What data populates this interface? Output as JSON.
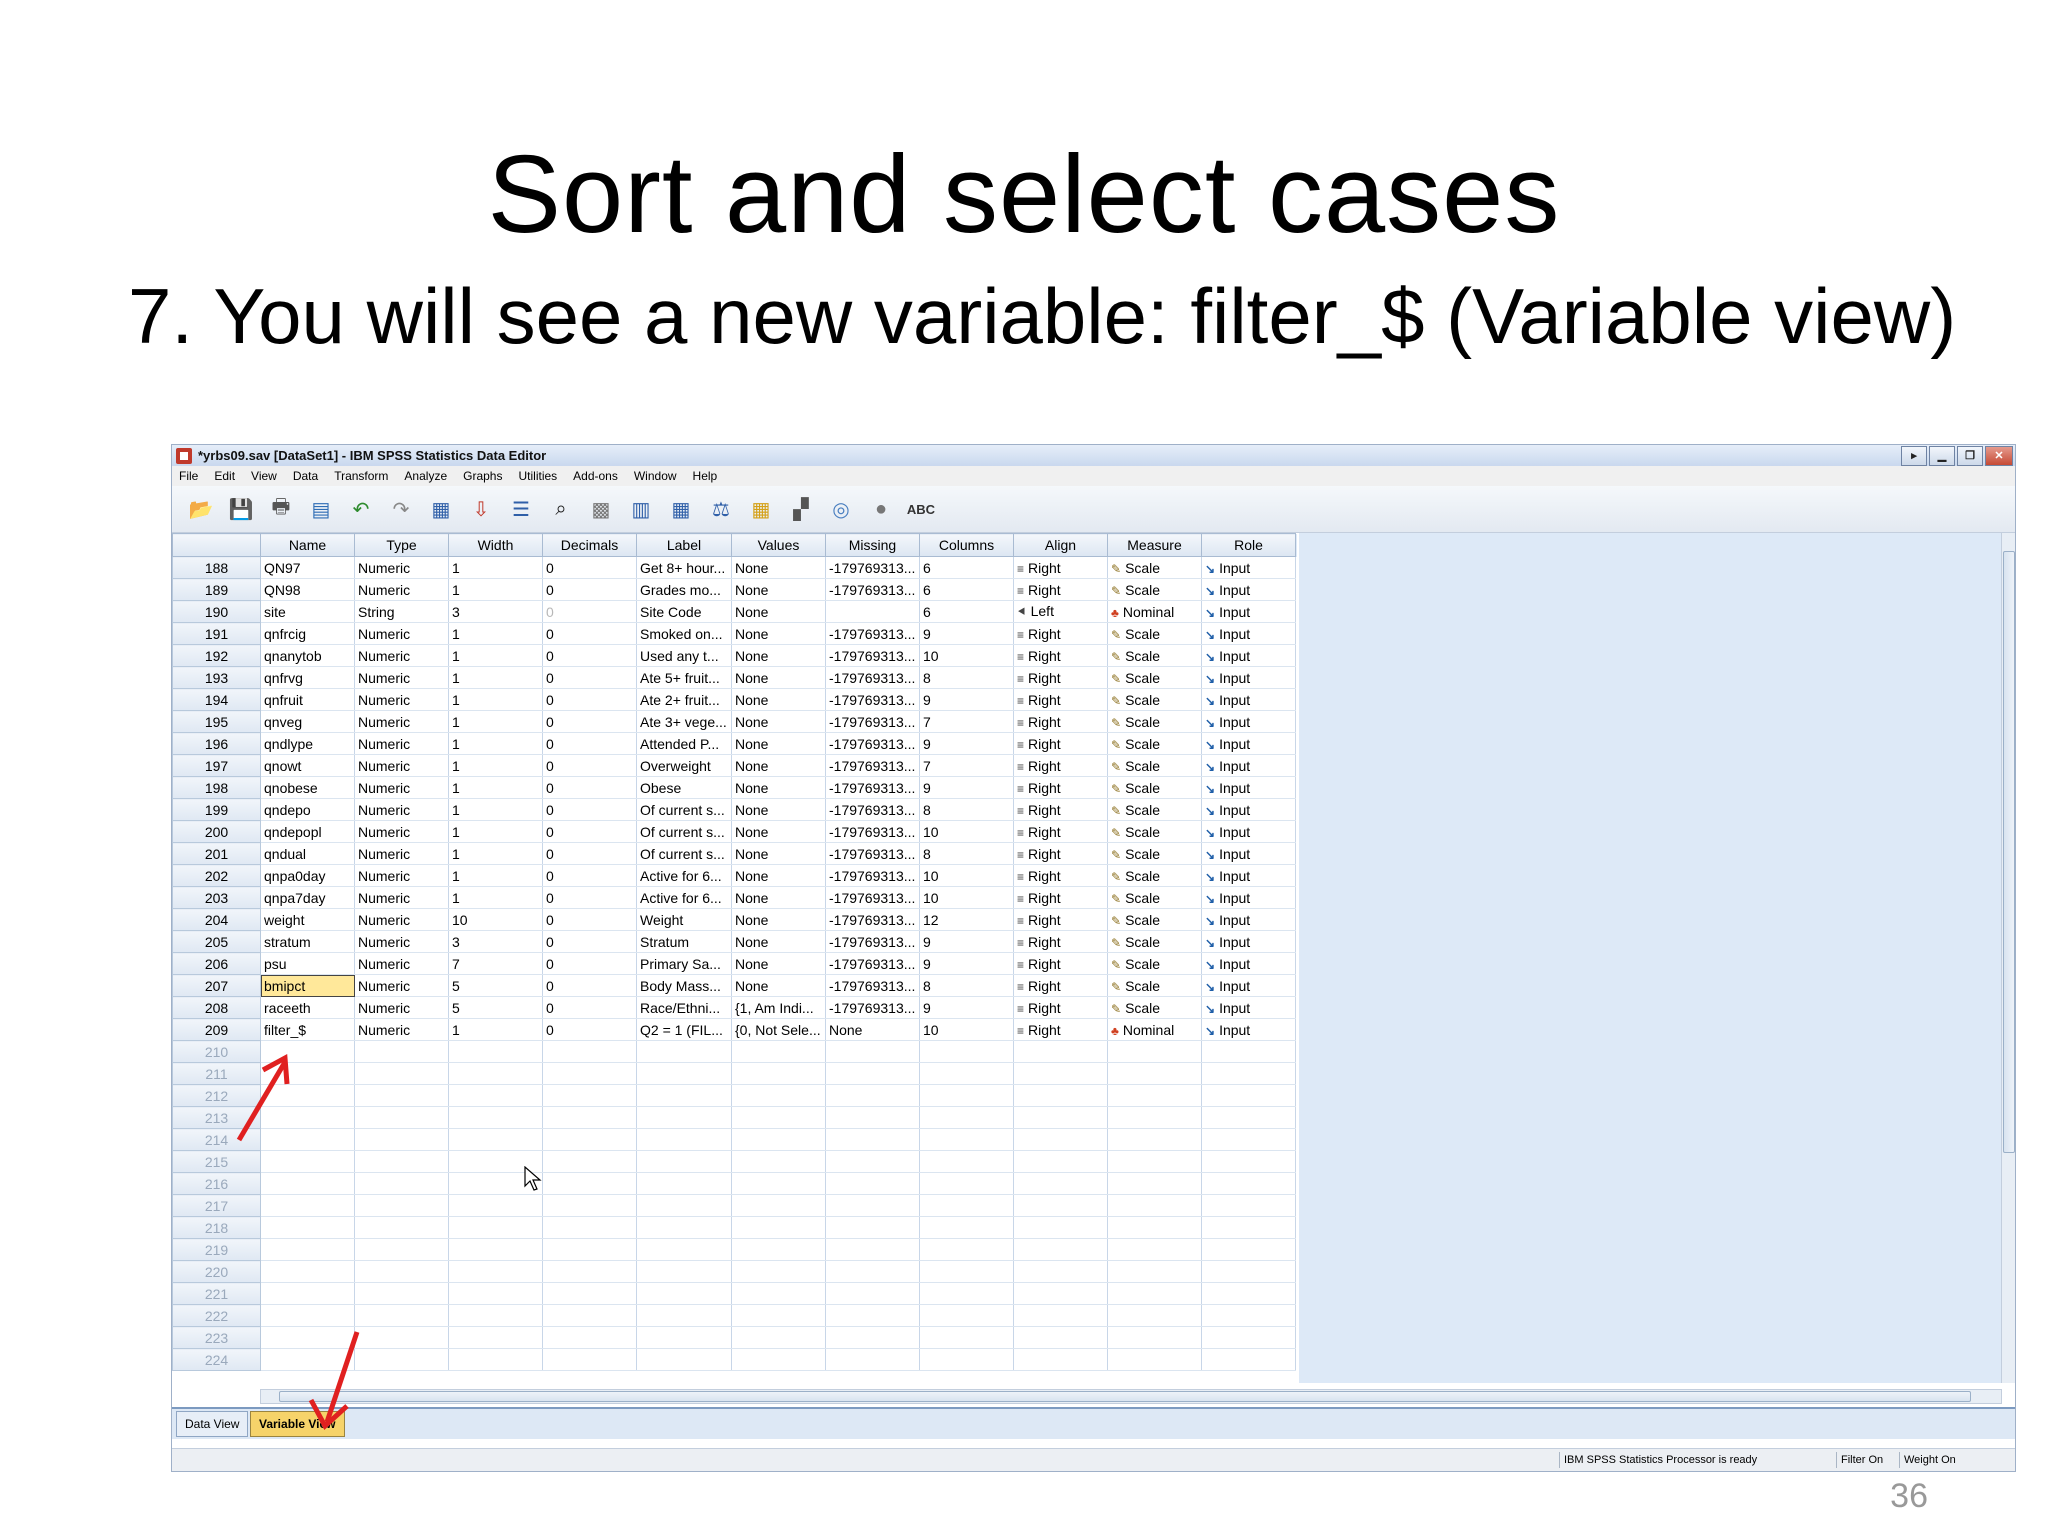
{
  "slide": {
    "title": "Sort and select cases",
    "subtitle": "7. You will see a new variable: filter_$ (Variable view)",
    "page_number": "36"
  },
  "window": {
    "title": "*yrbs09.sav [DataSet1] - IBM SPSS Statistics Data Editor"
  },
  "menu": [
    "File",
    "Edit",
    "View",
    "Data",
    "Transform",
    "Analyze",
    "Graphs",
    "Utilities",
    "Add-ons",
    "Window",
    "Help"
  ],
  "toolbar": {
    "icons": [
      "open-folder-icon",
      "save-icon",
      "print-icon",
      "recall-dialog-icon",
      "undo-icon",
      "redo-icon",
      "goto-case-icon",
      "goto-variable-icon",
      "variables-icon",
      "find-icon",
      "insert-cases-icon",
      "insert-variable-icon",
      "split-file-icon",
      "weight-cases-icon",
      "select-cases-icon",
      "value-labels-icon",
      "use-sets-icon",
      "show-all-icon",
      "spell-check-icon"
    ]
  },
  "grid": {
    "columns": [
      "Name",
      "Type",
      "Width",
      "Decimals",
      "Label",
      "Values",
      "Missing",
      "Columns",
      "Align",
      "Measure",
      "Role"
    ],
    "rows": [
      {
        "n": "188",
        "name": "QN97",
        "type": "Numeric",
        "width": "1",
        "decimals": "0",
        "label": "Get 8+ hour...",
        "values": "None",
        "missing": "-179769313...",
        "columns": "6",
        "align": "Right",
        "measure": "Scale",
        "role": "Input"
      },
      {
        "n": "189",
        "name": "QN98",
        "type": "Numeric",
        "width": "1",
        "decimals": "0",
        "label": "Grades mo...",
        "values": "None",
        "missing": "-179769313...",
        "columns": "6",
        "align": "Right",
        "measure": "Scale",
        "role": "Input"
      },
      {
        "n": "190",
        "name": "site",
        "type": "String",
        "width": "3",
        "decimals": "0",
        "label": "Site Code",
        "values": "None",
        "missing": "",
        "columns": "6",
        "align": "Left",
        "measure": "Nominal",
        "role": "Input"
      },
      {
        "n": "191",
        "name": "qnfrcig",
        "type": "Numeric",
        "width": "1",
        "decimals": "0",
        "label": "Smoked on...",
        "values": "None",
        "missing": "-179769313...",
        "columns": "9",
        "align": "Right",
        "measure": "Scale",
        "role": "Input"
      },
      {
        "n": "192",
        "name": "qnanytob",
        "type": "Numeric",
        "width": "1",
        "decimals": "0",
        "label": "Used any t...",
        "values": "None",
        "missing": "-179769313...",
        "columns": "10",
        "align": "Right",
        "measure": "Scale",
        "role": "Input"
      },
      {
        "n": "193",
        "name": "qnfrvg",
        "type": "Numeric",
        "width": "1",
        "decimals": "0",
        "label": "Ate 5+ fruit...",
        "values": "None",
        "missing": "-179769313...",
        "columns": "8",
        "align": "Right",
        "measure": "Scale",
        "role": "Input"
      },
      {
        "n": "194",
        "name": "qnfruit",
        "type": "Numeric",
        "width": "1",
        "decimals": "0",
        "label": "Ate 2+ fruit...",
        "values": "None",
        "missing": "-179769313...",
        "columns": "9",
        "align": "Right",
        "measure": "Scale",
        "role": "Input"
      },
      {
        "n": "195",
        "name": "qnveg",
        "type": "Numeric",
        "width": "1",
        "decimals": "0",
        "label": "Ate 3+ vege...",
        "values": "None",
        "missing": "-179769313...",
        "columns": "7",
        "align": "Right",
        "measure": "Scale",
        "role": "Input"
      },
      {
        "n": "196",
        "name": "qndlype",
        "type": "Numeric",
        "width": "1",
        "decimals": "0",
        "label": "Attended P...",
        "values": "None",
        "missing": "-179769313...",
        "columns": "9",
        "align": "Right",
        "measure": "Scale",
        "role": "Input"
      },
      {
        "n": "197",
        "name": "qnowt",
        "type": "Numeric",
        "width": "1",
        "decimals": "0",
        "label": "Overweight",
        "values": "None",
        "missing": "-179769313...",
        "columns": "7",
        "align": "Right",
        "measure": "Scale",
        "role": "Input"
      },
      {
        "n": "198",
        "name": "qnobese",
        "type": "Numeric",
        "width": "1",
        "decimals": "0",
        "label": "Obese",
        "values": "None",
        "missing": "-179769313...",
        "columns": "9",
        "align": "Right",
        "measure": "Scale",
        "role": "Input"
      },
      {
        "n": "199",
        "name": "qndepo",
        "type": "Numeric",
        "width": "1",
        "decimals": "0",
        "label": "Of current s...",
        "values": "None",
        "missing": "-179769313...",
        "columns": "8",
        "align": "Right",
        "measure": "Scale",
        "role": "Input"
      },
      {
        "n": "200",
        "name": "qndepopl",
        "type": "Numeric",
        "width": "1",
        "decimals": "0",
        "label": "Of current s...",
        "values": "None",
        "missing": "-179769313...",
        "columns": "10",
        "align": "Right",
        "measure": "Scale",
        "role": "Input"
      },
      {
        "n": "201",
        "name": "qndual",
        "type": "Numeric",
        "width": "1",
        "decimals": "0",
        "label": "Of current s...",
        "values": "None",
        "missing": "-179769313...",
        "columns": "8",
        "align": "Right",
        "measure": "Scale",
        "role": "Input"
      },
      {
        "n": "202",
        "name": "qnpa0day",
        "type": "Numeric",
        "width": "1",
        "decimals": "0",
        "label": "Active for 6...",
        "values": "None",
        "missing": "-179769313...",
        "columns": "10",
        "align": "Right",
        "measure": "Scale",
        "role": "Input"
      },
      {
        "n": "203",
        "name": "qnpa7day",
        "type": "Numeric",
        "width": "1",
        "decimals": "0",
        "label": "Active for 6...",
        "values": "None",
        "missing": "-179769313...",
        "columns": "10",
        "align": "Right",
        "measure": "Scale",
        "role": "Input"
      },
      {
        "n": "204",
        "name": "weight",
        "type": "Numeric",
        "width": "10",
        "decimals": "0",
        "label": "Weight",
        "values": "None",
        "missing": "-179769313...",
        "columns": "12",
        "align": "Right",
        "measure": "Scale",
        "role": "Input"
      },
      {
        "n": "205",
        "name": "stratum",
        "type": "Numeric",
        "width": "3",
        "decimals": "0",
        "label": "Stratum",
        "values": "None",
        "missing": "-179769313...",
        "columns": "9",
        "align": "Right",
        "measure": "Scale",
        "role": "Input"
      },
      {
        "n": "206",
        "name": "psu",
        "type": "Numeric",
        "width": "7",
        "decimals": "0",
        "label": "Primary Sa...",
        "values": "None",
        "missing": "-179769313...",
        "columns": "9",
        "align": "Right",
        "measure": "Scale",
        "role": "Input"
      },
      {
        "n": "207",
        "name": "bmipct",
        "type": "Numeric",
        "width": "5",
        "decimals": "0",
        "label": "Body Mass...",
        "values": "None",
        "missing": "-179769313...",
        "columns": "8",
        "align": "Right",
        "measure": "Scale",
        "role": "Input"
      },
      {
        "n": "208",
        "name": "raceeth",
        "type": "Numeric",
        "width": "5",
        "decimals": "0",
        "label": "Race/Ethni...",
        "values": "{1, Am Indi...",
        "missing": "-179769313...",
        "columns": "9",
        "align": "Right",
        "measure": "Scale",
        "role": "Input"
      },
      {
        "n": "209",
        "name": "filter_$",
        "type": "Numeric",
        "width": "1",
        "decimals": "0",
        "label": "Q2 = 1 (FIL...",
        "values": "{0, Not Sele...",
        "missing": "None",
        "columns": "10",
        "align": "Right",
        "measure": "Nominal",
        "role": "Input"
      }
    ],
    "empty_rows": [
      "210",
      "211",
      "212",
      "213",
      "214",
      "215",
      "216",
      "217",
      "218",
      "219",
      "220",
      "221",
      "222",
      "223",
      "224"
    ]
  },
  "tabs": [
    "Data View",
    "Variable View"
  ],
  "status": {
    "processor": "IBM SPSS Statistics Processor is ready",
    "filter": "Filter On",
    "weight": "Weight On"
  }
}
